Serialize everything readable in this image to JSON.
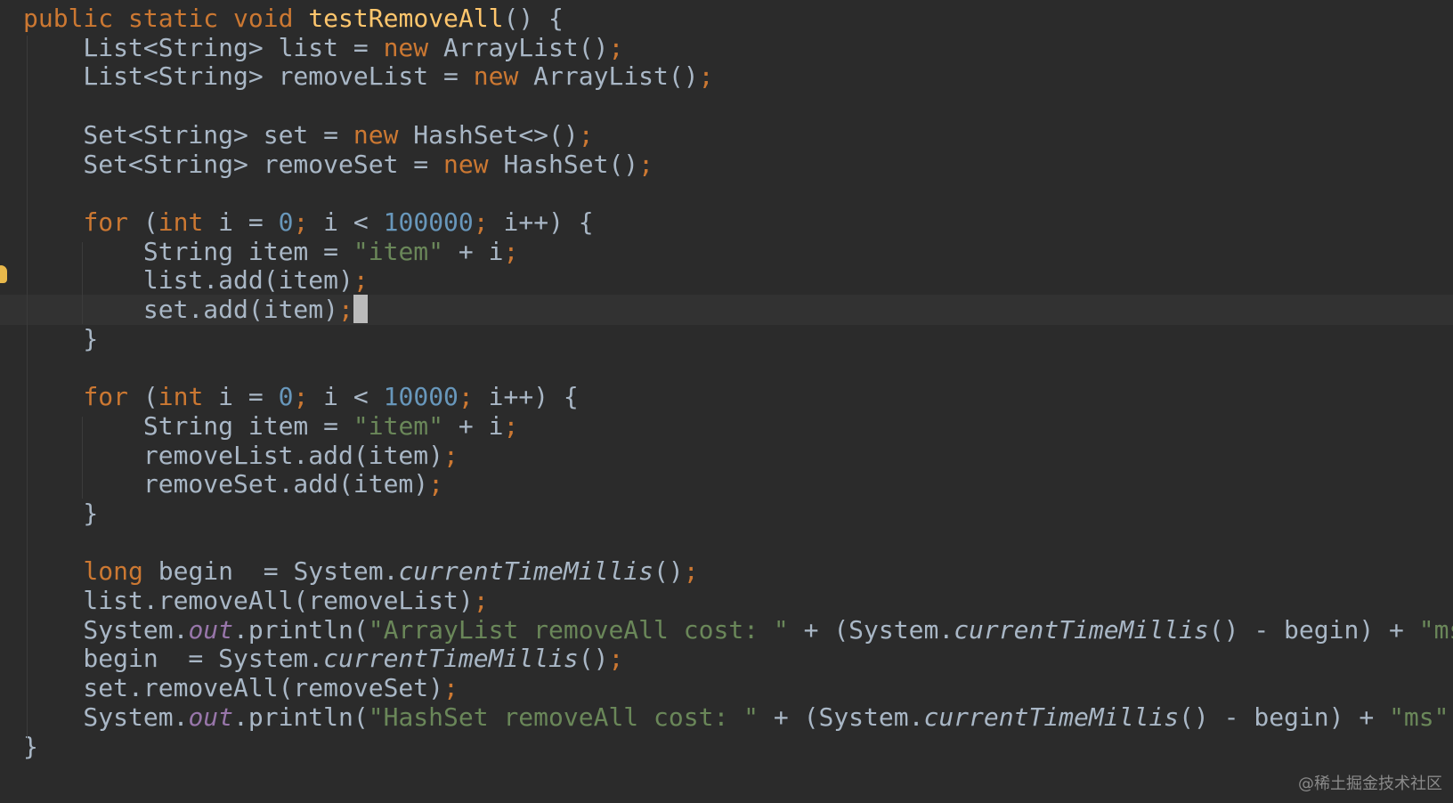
{
  "editor": {
    "lines": [
      {
        "text": "public static void testRemoveAll() {"
      },
      {
        "text": "    List<String> list = new ArrayList();"
      },
      {
        "text": "    List<String> removeList = new ArrayList();"
      },
      {
        "text": ""
      },
      {
        "text": "    Set<String> set = new HashSet<>();"
      },
      {
        "text": "    Set<String> removeSet = new HashSet();"
      },
      {
        "text": ""
      },
      {
        "text": "    for (int i = 0; i < 100000; i++) {"
      },
      {
        "text": "        String item = \"item\" + i;"
      },
      {
        "text": "        list.add(item);"
      },
      {
        "text": "        set.add(item);"
      },
      {
        "text": "    }"
      },
      {
        "text": ""
      },
      {
        "text": "    for (int i = 0; i < 10000; i++) {"
      },
      {
        "text": "        String item = \"item\" + i;"
      },
      {
        "text": "        removeList.add(item);"
      },
      {
        "text": "        removeSet.add(item);"
      },
      {
        "text": "    }"
      },
      {
        "text": ""
      },
      {
        "text": "    long begin  = System.currentTimeMillis();"
      },
      {
        "text": "    list.removeAll(removeList);"
      },
      {
        "text": "    System.out.println(\"ArrayList removeAll cost: \" + (System.currentTimeMillis() - begin) + \"ms\");"
      },
      {
        "text": "    begin  = System.currentTimeMillis();"
      },
      {
        "text": "    set.removeAll(removeSet);"
      },
      {
        "text": "    System.out.println(\"HashSet removeAll cost: \" + (System.currentTimeMillis() - begin) + \"ms\");"
      },
      {
        "text": "}"
      }
    ],
    "current_line": 10,
    "gutter_icon": "lightbulb-icon"
  },
  "watermark": "@稀土掘金技术社区",
  "colors": {
    "background": "#2b2b2b",
    "current_line": "#323232",
    "keyword": "#cc7832",
    "method_declaration": "#ffc66d",
    "number": "#6897bb",
    "string": "#6a8759",
    "static_field": "#9876aa",
    "default_text": "#a9b7c6"
  }
}
